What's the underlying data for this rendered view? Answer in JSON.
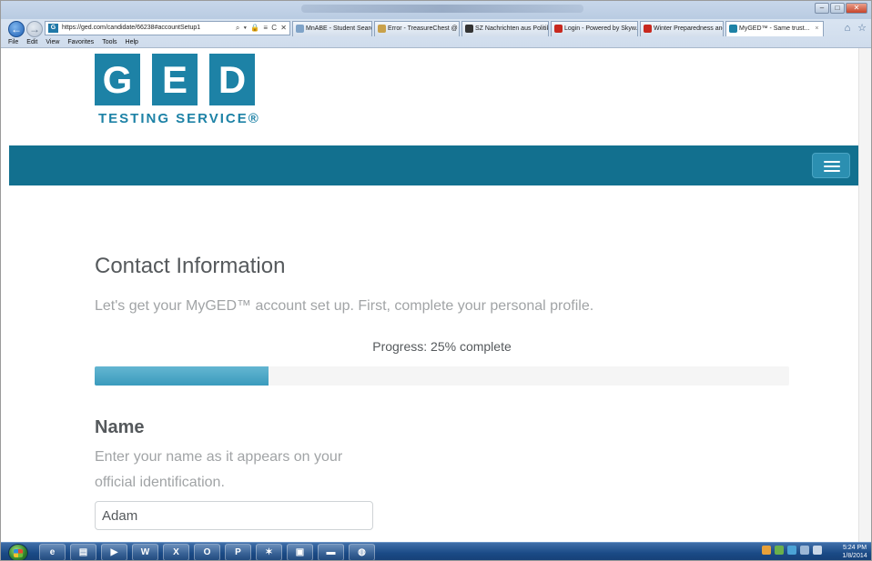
{
  "browser": {
    "url": "https://ged.com/candidate/66238#accountSetup1",
    "address_tools": "⌕ ▾ 🔒 ≡ C ✕",
    "menu": [
      "File",
      "Edit",
      "View",
      "Favorites",
      "Tools",
      "Help"
    ],
    "tabs": [
      {
        "label": "MnABE - Student Search",
        "icon": "folder-icon",
        "color": "#7fa3c8"
      },
      {
        "label": "Error - TreasureChest @ ...",
        "icon": "folder-icon",
        "color": "#c9a14a"
      },
      {
        "label": "SZ Nachrichten aus Politik, ...",
        "icon": "sz-icon",
        "color": "#333333"
      },
      {
        "label": "Login - Powered by Skyw...",
        "icon": "skyward-icon",
        "color": "#c8281e"
      },
      {
        "label": "Winter Preparedness and ...",
        "icon": "arrow-icon",
        "color": "#c8281e"
      },
      {
        "label": "MyGED™ - Same trust...",
        "icon": "ged-icon",
        "color": "#1d82a6",
        "active": true
      }
    ]
  },
  "logo": {
    "letters": [
      "G",
      "E",
      "D"
    ],
    "tagline": "TESTING SERVICE®",
    "color": "#1d82a6"
  },
  "header": {
    "bar_color": "#12708f",
    "menu_icon": "hamburger-menu-icon"
  },
  "main": {
    "title": "Contact Information",
    "subtitle": "Let's get your MyGED™ account set up. First, complete your personal profile.",
    "progress": {
      "label": "Progress: 25% complete",
      "percent": 25
    },
    "name_section": {
      "heading": "Name",
      "description": "Enter your name as it appears on your official identification.",
      "input_value": "Adam"
    }
  },
  "taskbar": {
    "apps": [
      "ie-icon",
      "explorer-icon",
      "media-player-icon",
      "word-icon",
      "excel-icon",
      "outlook-icon",
      "powerpoint-icon",
      "acrobat-icon",
      "photos-icon",
      "network-icon",
      "paint-icon"
    ],
    "app_glyphs": [
      "e",
      "▤",
      "▶",
      "W",
      "X",
      "O",
      "P",
      "✶",
      "▣",
      "▬",
      "◍"
    ],
    "clock_time": "5:24 PM",
    "clock_date": "1/8/2014"
  }
}
